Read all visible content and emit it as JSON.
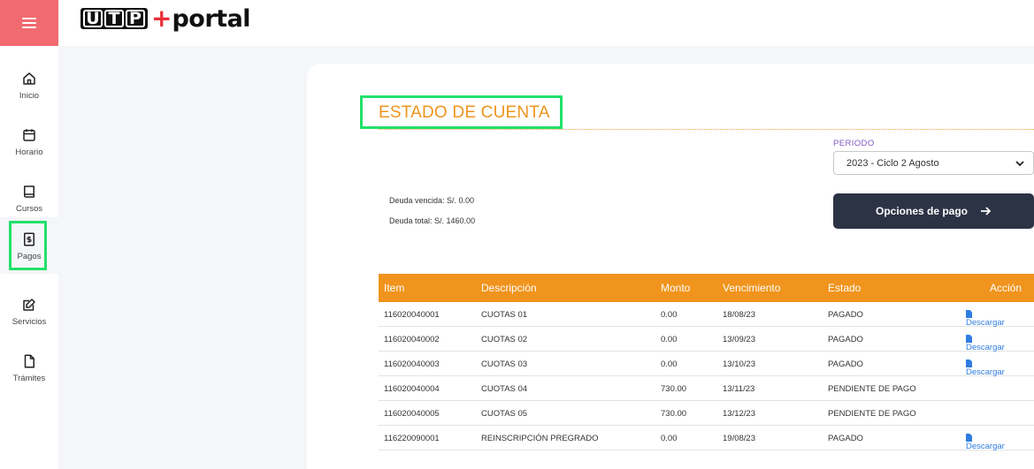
{
  "header": {
    "logo_letters": [
      "U",
      "T",
      "P"
    ],
    "logo_plus": "+",
    "logo_portal": "portal"
  },
  "sidebar": {
    "items": [
      {
        "label": "Inicio",
        "icon": "home-icon"
      },
      {
        "label": "Horario",
        "icon": "calendar-icon"
      },
      {
        "label": "Cursos",
        "icon": "book-icon"
      },
      {
        "label": "Pagos",
        "icon": "receipt-icon"
      },
      {
        "label": "Servicios",
        "icon": "edit-icon"
      },
      {
        "label": "Trámites",
        "icon": "file-icon"
      }
    ]
  },
  "main": {
    "title": "ESTADO DE CUENTA",
    "periodo_label": "PERIODO",
    "periodo_value": "2023 - Ciclo 2 Agosto",
    "deuda_vencida": "Deuda vencida: S/. 0.00",
    "deuda_total": "Deuda total: S/. 1460.00",
    "pay_button": "Opciones de pago"
  },
  "table": {
    "headers": {
      "item": "Item",
      "descripcion": "Descripción",
      "monto": "Monto",
      "vencimiento": "Vencimiento",
      "estado": "Estado",
      "accion": "Acción"
    },
    "rows": [
      {
        "item": "116020040001",
        "descripcion": "CUOTAS 01",
        "monto": "0.00",
        "vencimiento": "18/08/23",
        "estado": "PAGADO",
        "accion": "Descargar"
      },
      {
        "item": "116020040002",
        "descripcion": "CUOTAS 02",
        "monto": "0.00",
        "vencimiento": "13/09/23",
        "estado": "PAGADO",
        "accion": "Descargar"
      },
      {
        "item": "116020040003",
        "descripcion": "CUOTAS 03",
        "monto": "0.00",
        "vencimiento": "13/10/23",
        "estado": "PAGADO",
        "accion": "Descargar"
      },
      {
        "item": "116020040004",
        "descripcion": "CUOTAS 04",
        "monto": "730.00",
        "vencimiento": "13/11/23",
        "estado": "PENDIENTE DE PAGO",
        "accion": ""
      },
      {
        "item": "116020040005",
        "descripcion": "CUOTAS 05",
        "monto": "730.00",
        "vencimiento": "13/12/23",
        "estado": "PENDIENTE DE PAGO",
        "accion": ""
      },
      {
        "item": "116220090001",
        "descripcion": "REINSCRIPCIÓN PREGRADO",
        "monto": "0.00",
        "vencimiento": "19/08/23",
        "estado": "PAGADO",
        "accion": "Descargar"
      }
    ]
  },
  "colors": {
    "accent_orange": "#f0941d",
    "menu_red": "#f06a6f",
    "highlight_green": "#22e06b",
    "button_dark": "#2c3344",
    "link_blue": "#2f7de1"
  }
}
